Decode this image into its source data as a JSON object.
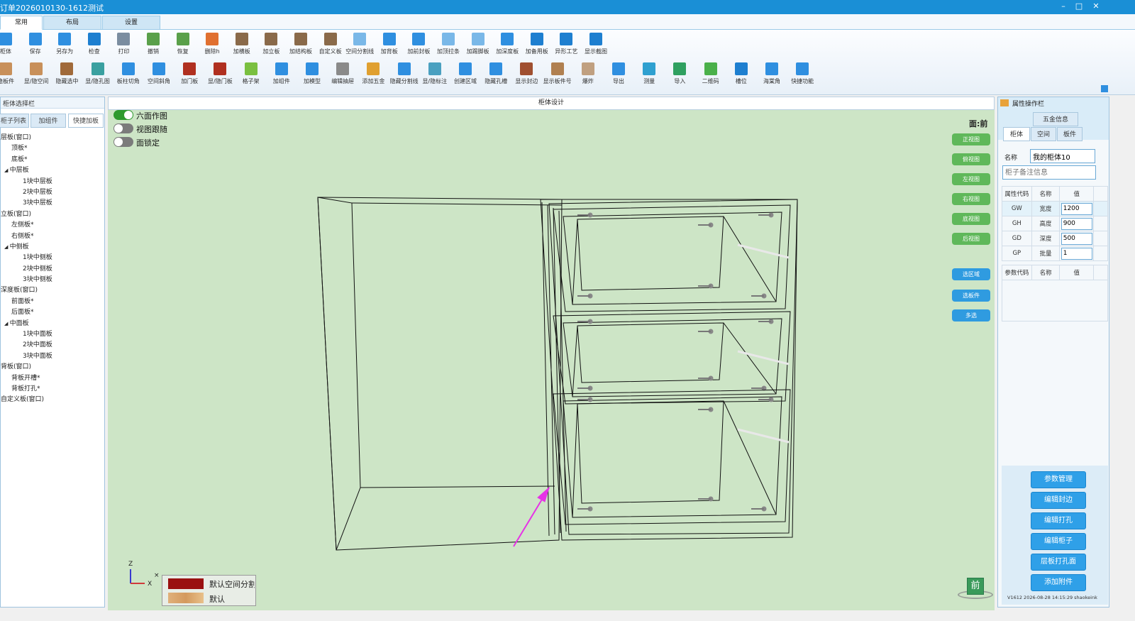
{
  "window": {
    "title": "订单2026010130-1612测试",
    "minimize": "–",
    "maximize": "□",
    "close": "✕"
  },
  "menu_tabs": [
    "常用",
    "布局",
    "设置"
  ],
  "ribbon_row1": [
    {
      "label": "柜体",
      "icon": "cabinet-icon",
      "color": "#2f8fe0"
    },
    {
      "label": "保存",
      "icon": "save-icon",
      "color": "#2f8fe0"
    },
    {
      "label": "另存为",
      "icon": "save-as-icon",
      "color": "#2f8fe0"
    },
    {
      "label": "检查",
      "icon": "check-icon",
      "color": "#1e7fd0"
    },
    {
      "label": "打印",
      "icon": "print-icon",
      "color": "#7b8da0"
    },
    {
      "label": "撤销",
      "icon": "undo-icon",
      "color": "#5aa04a"
    },
    {
      "label": "恢复",
      "icon": "redo-icon",
      "color": "#5aa04a"
    },
    {
      "label": "删除h",
      "icon": "delete-icon",
      "color": "#e07030"
    },
    {
      "label": "加横板",
      "icon": "add-horizontal-board-icon",
      "color": "#8a6a4a"
    },
    {
      "label": "加立板",
      "icon": "add-vertical-board-icon",
      "color": "#8a6a4a"
    },
    {
      "label": "加结构板",
      "icon": "add-structure-board-icon",
      "color": "#8a6a4a"
    },
    {
      "label": "自定义板",
      "icon": "custom-board-icon",
      "color": "#8a6a4a"
    },
    {
      "label": "空间分割线",
      "icon": "space-divider-icon",
      "color": "#7ab8e8"
    },
    {
      "label": "加背板",
      "icon": "add-back-board-icon",
      "color": "#2f8fe0"
    },
    {
      "label": "加前封板",
      "icon": "add-front-seal-icon",
      "color": "#2f8fe0"
    },
    {
      "label": "加顶拉条",
      "icon": "add-top-strip-icon",
      "color": "#7ab8e8"
    },
    {
      "label": "加踢脚板",
      "icon": "add-kick-board-icon",
      "color": "#7ab8e8"
    },
    {
      "label": "加深度板",
      "icon": "add-depth-board-icon",
      "color": "#2f8fe0"
    },
    {
      "label": "加备用板",
      "icon": "add-spare-board-icon",
      "color": "#1e7fd0"
    },
    {
      "label": "异形工艺",
      "icon": "special-craft-icon",
      "color": "#1e7fd0"
    },
    {
      "label": "显示截图",
      "icon": "screenshot-icon",
      "color": "#1e7fd0"
    }
  ],
  "ribbon_row2": [
    {
      "label": "隐板件",
      "icon": "hide-parts-icon",
      "color": "#c8905a"
    },
    {
      "label": "显/隐空间",
      "icon": "toggle-space-icon",
      "color": "#c8905a"
    },
    {
      "label": "隐藏选中",
      "icon": "hide-selected-icon",
      "color": "#a06a3a"
    },
    {
      "label": "显/隐孔图",
      "icon": "toggle-holes-icon",
      "color": "#3aa0a0"
    },
    {
      "label": "板柱切角",
      "icon": "corner-cut-icon",
      "color": "#2f8fe0"
    },
    {
      "label": "空间斜角",
      "icon": "space-bevel-icon",
      "color": "#2f8fe0"
    },
    {
      "label": "加门板",
      "icon": "add-door-icon",
      "color": "#b03020"
    },
    {
      "label": "显/隐门板",
      "icon": "toggle-door-icon",
      "color": "#b03020"
    },
    {
      "label": "格子架",
      "icon": "grid-rack-icon",
      "color": "#7ac040"
    },
    {
      "label": "加组件",
      "icon": "add-component-icon",
      "color": "#2f8fe0"
    },
    {
      "label": "加模型",
      "icon": "add-model-icon",
      "color": "#2f8fe0"
    },
    {
      "label": "编辑抽屉",
      "icon": "edit-drawer-icon",
      "color": "#8a8a8a"
    },
    {
      "label": "添加五金",
      "icon": "add-hardware-icon",
      "color": "#e0a030"
    },
    {
      "label": "隐藏分割线",
      "icon": "hide-divider-icon",
      "color": "#2f8fe0"
    },
    {
      "label": "显/隐标注",
      "icon": "toggle-annotation-icon",
      "color": "#4aa0c0"
    },
    {
      "label": "创建区域",
      "icon": "create-region-icon",
      "color": "#2f8fe0"
    },
    {
      "label": "隐藏孔槽",
      "icon": "hide-slot-icon",
      "color": "#2f8fe0"
    },
    {
      "label": "显示封边",
      "icon": "show-edge-icon",
      "color": "#a05030"
    },
    {
      "label": "显示板件号",
      "icon": "show-part-number-icon",
      "color": "#b08050"
    },
    {
      "label": "爆炸",
      "icon": "explode-icon",
      "color": "#c0a080"
    },
    {
      "label": "导出",
      "icon": "export-icon",
      "color": "#2f8fe0"
    },
    {
      "label": "测量",
      "icon": "measure-icon",
      "color": "#2fa0d0"
    },
    {
      "label": "导入",
      "icon": "import-icon",
      "color": "#2fa060"
    },
    {
      "label": "二维码",
      "icon": "qrcode-icon",
      "color": "#4ab04a"
    },
    {
      "label": "槽位",
      "icon": "slot-icon",
      "color": "#1e7fd0"
    },
    {
      "label": "海棠角",
      "icon": "begonia-corner-icon",
      "color": "#2f8fe0"
    },
    {
      "label": "快捷功能",
      "icon": "shortcut-icon",
      "color": "#2f8fe0"
    }
  ],
  "left_panel": {
    "title": "柜体选择栏",
    "tabs": [
      "柜子列表",
      "加组件",
      "快捷加板"
    ],
    "tree": [
      {
        "text": "层板(窗口)",
        "level": 0,
        "expander": ""
      },
      {
        "text": "顶板*",
        "level": 1,
        "expander": ""
      },
      {
        "text": "底板*",
        "level": 1,
        "expander": ""
      },
      {
        "text": "中层板",
        "level": 1,
        "expander": "◢"
      },
      {
        "text": "1块中层板",
        "level": 2,
        "expander": ""
      },
      {
        "text": "2块中层板",
        "level": 2,
        "expander": ""
      },
      {
        "text": "3块中层板",
        "level": 2,
        "expander": ""
      },
      {
        "text": "立板(窗口)",
        "level": 0,
        "expander": ""
      },
      {
        "text": "左侧板*",
        "level": 1,
        "expander": ""
      },
      {
        "text": "右侧板*",
        "level": 1,
        "expander": ""
      },
      {
        "text": "中侧板",
        "level": 1,
        "expander": "◢"
      },
      {
        "text": "1块中侧板",
        "level": 2,
        "expander": ""
      },
      {
        "text": "2块中侧板",
        "level": 2,
        "expander": ""
      },
      {
        "text": "3块中侧板",
        "level": 2,
        "expander": ""
      },
      {
        "text": "深度板(窗口)",
        "level": 0,
        "expander": ""
      },
      {
        "text": "前面板*",
        "level": 1,
        "expander": ""
      },
      {
        "text": "后面板*",
        "level": 1,
        "expander": ""
      },
      {
        "text": "中面板",
        "level": 1,
        "expander": "◢"
      },
      {
        "text": "1块中面板",
        "level": 2,
        "expander": ""
      },
      {
        "text": "2块中面板",
        "level": 2,
        "expander": ""
      },
      {
        "text": "3块中面板",
        "level": 2,
        "expander": ""
      },
      {
        "text": "背板(窗口)",
        "level": 0,
        "expander": ""
      },
      {
        "text": "背板开槽*",
        "level": 1,
        "expander": ""
      },
      {
        "text": "背板打孔*",
        "level": 1,
        "expander": ""
      },
      {
        "text": "自定义板(窗口)",
        "level": 0,
        "expander": ""
      }
    ]
  },
  "center": {
    "title": "柜体设计",
    "toggles": [
      {
        "label": "六面作图",
        "on": true
      },
      {
        "label": "视图跟随",
        "on": false
      },
      {
        "label": "面锁定",
        "on": false
      }
    ],
    "face_label": "面:前",
    "view_buttons": [
      "正视图",
      "俯视图",
      "左视图",
      "右视图",
      "底视图",
      "后视图"
    ],
    "select_buttons": [
      "选区域",
      "选板件",
      "多选"
    ],
    "axis": {
      "z": "Z",
      "x": "X"
    },
    "legend": [
      {
        "label": "默认空间分割",
        "color": "#9a1010"
      },
      {
        "label": "默认",
        "color": "#e0b07a"
      }
    ],
    "view_cube_label": "前"
  },
  "right_panel": {
    "title": "属性操作栏",
    "hardware_tab": "五金信息",
    "tabs": [
      "柜体",
      "空间",
      "板件"
    ],
    "name_label": "名称",
    "name_value": "我的柜体10",
    "remark_placeholder": "柜子备注信息",
    "attr_headers": [
      "属性代码",
      "名称",
      "值"
    ],
    "attrs": [
      {
        "code": "GW",
        "name": "宽度",
        "value": "1200"
      },
      {
        "code": "GH",
        "name": "高度",
        "value": "900"
      },
      {
        "code": "GD",
        "name": "深度",
        "value": "500"
      },
      {
        "code": "GP",
        "name": "批量",
        "value": "1"
      }
    ],
    "param_headers": [
      "参数代码",
      "名称",
      "值"
    ],
    "actions": [
      "参数管理",
      "编辑封边",
      "编辑打孔",
      "编辑柜子",
      "层板打孔面",
      "添加附件"
    ],
    "version": "V1612 2026-08-28 14:15:29 shaokeink"
  },
  "colors": {
    "accent": "#1a8fd6",
    "viewport_bg": "#cde5c6",
    "view_button": "#5fb85a",
    "select_button": "#2f9be0",
    "arrow": "#e632e6"
  }
}
